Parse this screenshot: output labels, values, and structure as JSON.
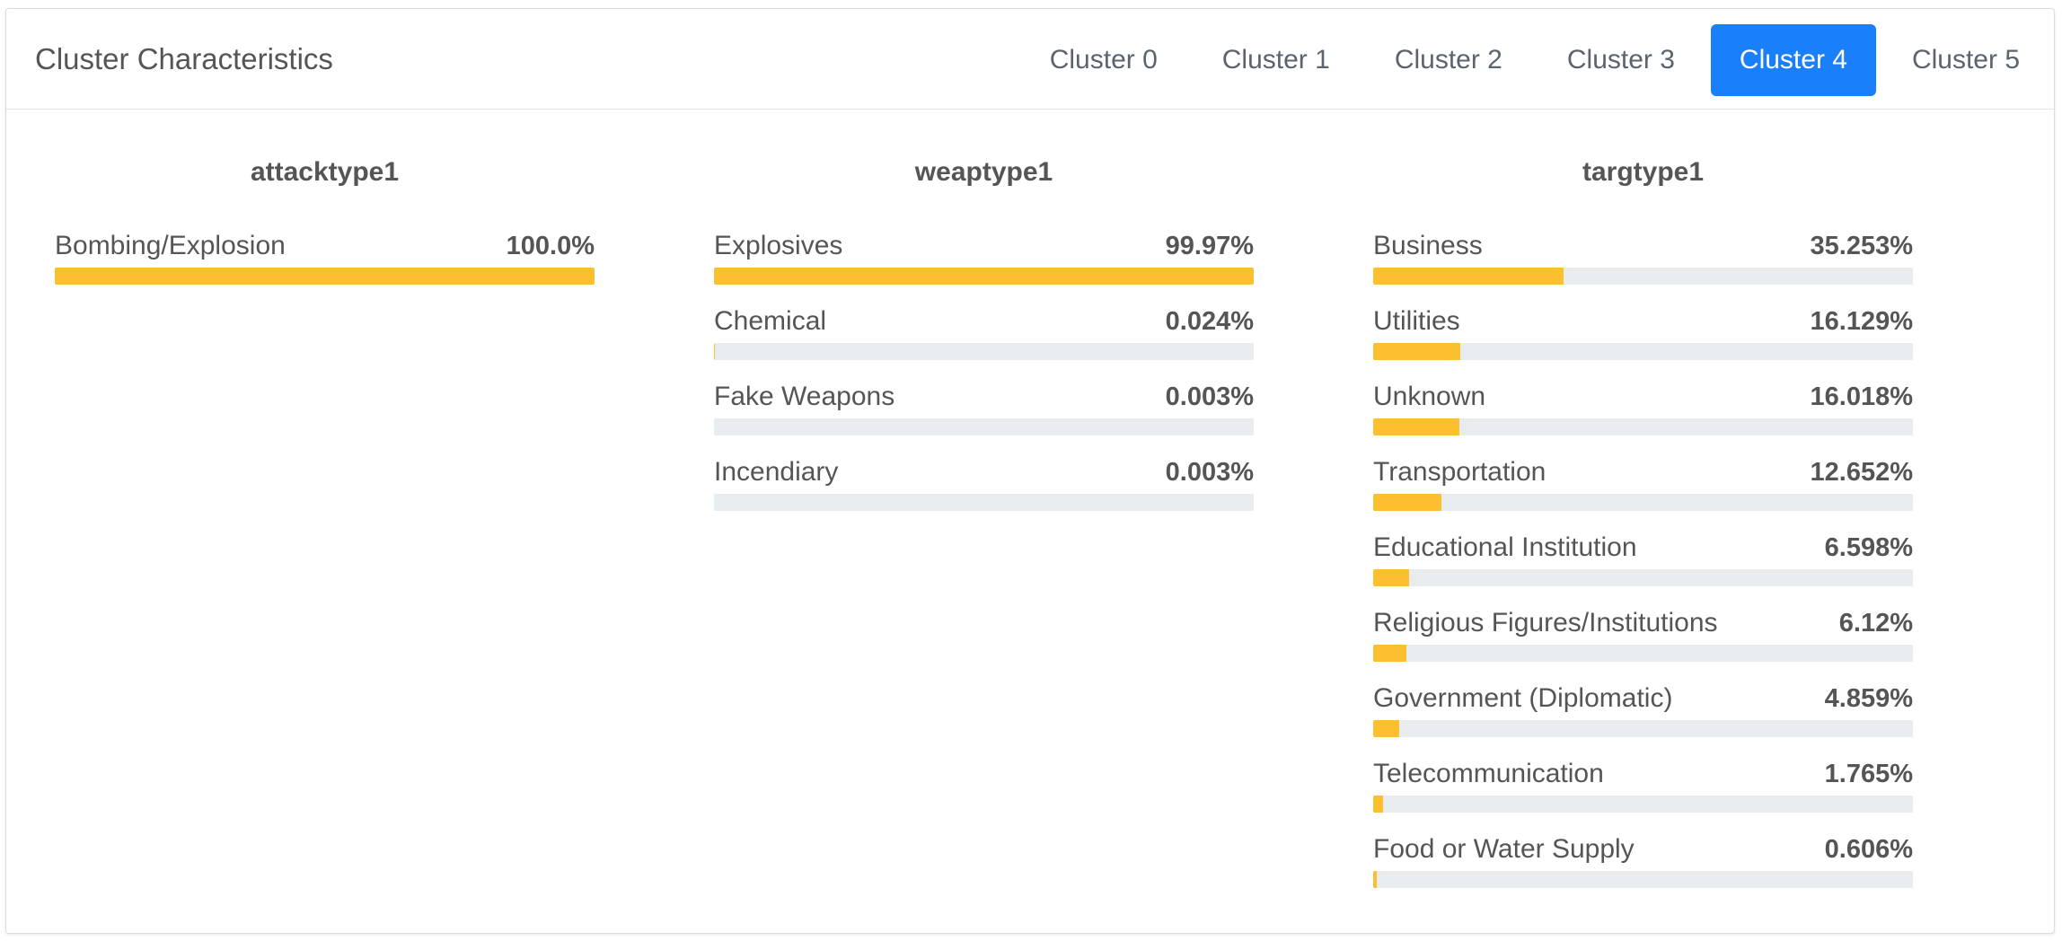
{
  "header": {
    "title": "Cluster Characteristics",
    "tabs": [
      {
        "label": "Cluster 0",
        "active": false
      },
      {
        "label": "Cluster 1",
        "active": false
      },
      {
        "label": "Cluster 2",
        "active": false
      },
      {
        "label": "Cluster 3",
        "active": false
      },
      {
        "label": "Cluster 4",
        "active": true
      },
      {
        "label": "Cluster 5",
        "active": false
      }
    ]
  },
  "colors": {
    "accent": "#1a7ffb",
    "bar_fill": "#fbbf2f",
    "bar_track": "#e9ecef"
  },
  "columns": [
    {
      "title": "attacktype1",
      "rows": [
        {
          "label": "Bombing/Explosion",
          "value_text": "100.0%",
          "percent": 100.0
        }
      ]
    },
    {
      "title": "weaptype1",
      "rows": [
        {
          "label": "Explosives",
          "value_text": "99.97%",
          "percent": 99.97
        },
        {
          "label": "Chemical",
          "value_text": "0.024%",
          "percent": 0.024
        },
        {
          "label": "Fake Weapons",
          "value_text": "0.003%",
          "percent": 0.003
        },
        {
          "label": "Incendiary",
          "value_text": "0.003%",
          "percent": 0.003
        }
      ]
    },
    {
      "title": "targtype1",
      "rows": [
        {
          "label": "Business",
          "value_text": "35.253%",
          "percent": 35.253
        },
        {
          "label": "Utilities",
          "value_text": "16.129%",
          "percent": 16.129
        },
        {
          "label": "Unknown",
          "value_text": "16.018%",
          "percent": 16.018
        },
        {
          "label": "Transportation",
          "value_text": "12.652%",
          "percent": 12.652
        },
        {
          "label": "Educational Institution",
          "value_text": "6.598%",
          "percent": 6.598
        },
        {
          "label": "Religious Figures/Institutions",
          "value_text": "6.12%",
          "percent": 6.12
        },
        {
          "label": "Government (Diplomatic)",
          "value_text": "4.859%",
          "percent": 4.859
        },
        {
          "label": "Telecommunication",
          "value_text": "1.765%",
          "percent": 1.765
        },
        {
          "label": "Food or Water Supply",
          "value_text": "0.606%",
          "percent": 0.606
        }
      ]
    }
  ]
}
